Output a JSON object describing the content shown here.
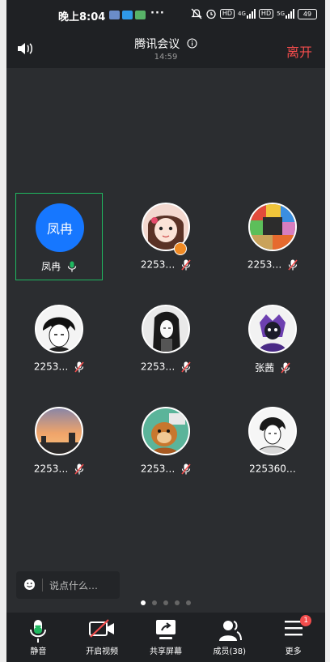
{
  "status_bar": {
    "time": "晚上8:04",
    "dots": "···",
    "net1": "HD",
    "net1_gen": "4G",
    "net2": "HD",
    "net2_gen": "5G",
    "battery": "49"
  },
  "header": {
    "title": "腾讯会议",
    "info_icon": "info-icon",
    "duration": "14:59",
    "leave_label": "离开",
    "speaker_icon": "speaker-icon"
  },
  "participants": [
    {
      "name": "凤冉",
      "avatar_text": "凤冉",
      "mic": "on",
      "active": true
    },
    {
      "name": "2253…",
      "mic": "muted"
    },
    {
      "name": "2253…",
      "mic": "muted"
    },
    {
      "name": "2253…",
      "mic": "muted"
    },
    {
      "name": "2253…",
      "mic": "muted"
    },
    {
      "name": "张茜",
      "mic": "muted"
    },
    {
      "name": "2253…",
      "mic": "muted"
    },
    {
      "name": "2253…",
      "mic": "muted"
    },
    {
      "name": "225360…",
      "mic": "none"
    }
  ],
  "chat": {
    "placeholder": "说点什么…"
  },
  "pager": {
    "pages": 5,
    "current": 1
  },
  "toolbar": {
    "mute": "静音",
    "video": "开启视频",
    "share": "共享屏幕",
    "members": "成员(38)",
    "more": "更多",
    "more_badge": "1"
  },
  "colors": {
    "accent_green": "#1fb860",
    "leave_red": "#f24c4c",
    "avatar_blue": "#1677ff"
  }
}
